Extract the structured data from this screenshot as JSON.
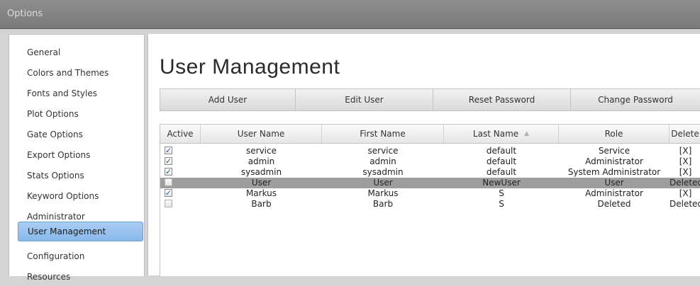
{
  "window": {
    "title": "Options"
  },
  "sidebar": {
    "items": [
      {
        "label": "General",
        "selected": false
      },
      {
        "label": "Colors and Themes",
        "selected": false
      },
      {
        "label": "Fonts and Styles",
        "selected": false
      },
      {
        "label": "Plot Options",
        "selected": false
      },
      {
        "label": "Gate Options",
        "selected": false
      },
      {
        "label": "Export Options",
        "selected": false
      },
      {
        "label": "Stats Options",
        "selected": false
      },
      {
        "label": "Keyword Options",
        "selected": false
      },
      {
        "label": "Administrator",
        "selected": false
      },
      {
        "label": "User Management",
        "selected": true
      },
      {
        "label": "Configuration",
        "selected": false
      },
      {
        "label": "Resources",
        "selected": false
      }
    ]
  },
  "main": {
    "title": "User Management",
    "toolbar": {
      "add_user": "Add User",
      "edit_user": "Edit User",
      "reset_password": "Reset Password",
      "change_password": "Change Password"
    },
    "table": {
      "columns": [
        "Active",
        "User Name",
        "First Name",
        "Last Name",
        "Role",
        "Delete"
      ],
      "sorted_column": "Last Name",
      "rows": [
        {
          "active": true,
          "user_name": "service",
          "first_name": "service",
          "last_name": "default",
          "role": "Service",
          "delete": "[X]",
          "selected": false
        },
        {
          "active": true,
          "user_name": "admin",
          "first_name": "admin",
          "last_name": "default",
          "role": "Administrator",
          "delete": "[X]",
          "selected": false
        },
        {
          "active": true,
          "user_name": "sysadmin",
          "first_name": "sysadmin",
          "last_name": "default",
          "role": "System Administrator",
          "delete": "[X]",
          "selected": false
        },
        {
          "active": false,
          "user_name": "User",
          "first_name": "User",
          "last_name": "NewUser",
          "role": "User",
          "delete": "Deleted",
          "selected": true
        },
        {
          "active": true,
          "user_name": "Markus",
          "first_name": "Markus",
          "last_name": "S",
          "role": "Administrator",
          "delete": "[X]",
          "selected": false
        },
        {
          "active": false,
          "user_name": "Barb",
          "first_name": "Barb",
          "last_name": "S",
          "role": "Deleted",
          "delete": "Deleted",
          "selected": false
        }
      ]
    }
  },
  "colors": {
    "selection_blue": "#8ab8ea",
    "row_selected": "#9e9e9e",
    "title_bar": "#838383"
  }
}
